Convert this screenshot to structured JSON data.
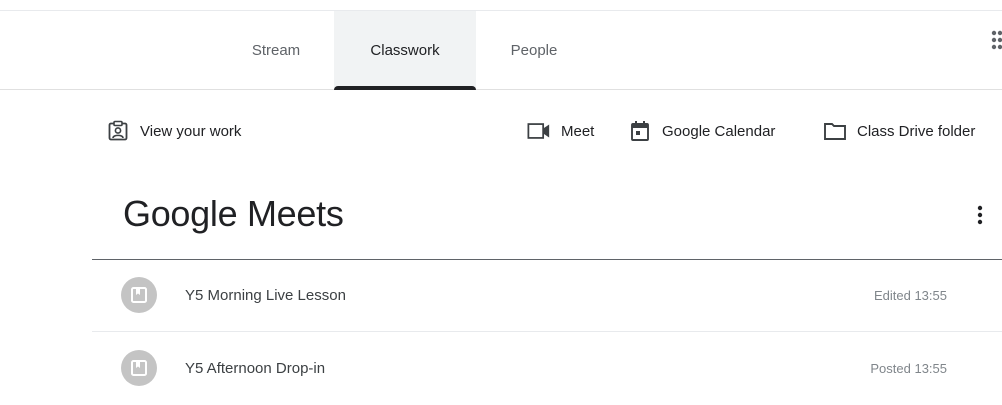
{
  "nav": {
    "tabs": [
      {
        "label": "Stream",
        "active": false
      },
      {
        "label": "Classwork",
        "active": true
      },
      {
        "label": "People",
        "active": false
      }
    ],
    "apps_icon": "apps-grid-icon"
  },
  "toolbar": {
    "view_work": {
      "label": "View your work",
      "icon": "assignment-person-icon"
    },
    "meet": {
      "label": "Meet",
      "icon": "video-camera-icon"
    },
    "calendar": {
      "label": "Google Calendar",
      "icon": "calendar-icon"
    },
    "drive": {
      "label": "Class Drive folder",
      "icon": "folder-icon"
    }
  },
  "section": {
    "title": "Google Meets",
    "items": [
      {
        "title": "Y5 Morning Live Lesson",
        "status": "Edited 13:55",
        "icon": "material-book-icon"
      },
      {
        "title": "Y5 Afternoon Drop-in",
        "status": "Posted 13:55",
        "icon": "material-book-icon"
      }
    ]
  },
  "colors": {
    "active_tab_bg": "#f1f3f4",
    "active_indicator": "#202124",
    "avatar_bg": "#c4c4c4",
    "muted_text": "#80868b"
  }
}
